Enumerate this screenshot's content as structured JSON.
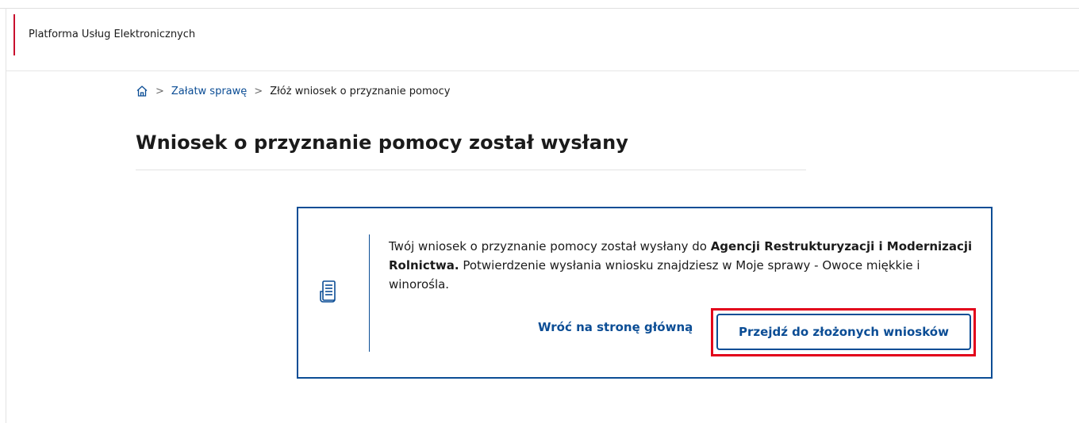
{
  "header": {
    "title": "Platforma Usług Elektronicznych"
  },
  "breadcrumb": {
    "items": [
      {
        "label": "Załatw sprawę"
      },
      {
        "label": "Złóż wniosek o przyznanie pomocy"
      }
    ],
    "separator": ">"
  },
  "page": {
    "title": "Wniosek o przyznanie pomocy został wysłany"
  },
  "panel": {
    "text_part1": "Twój wniosek o przyznanie pomocy został wysłany do ",
    "text_bold": "Agencji Restrukturyzacji i Modernizacji Rolnictwa.",
    "text_part2": " Potwierdzenie wysłania wniosku znajdziesz w Moje sprawy - Owoce miękkie i winorośla.",
    "link_home_label": "Wróć na stronę główną",
    "primary_button_label": "Przejdź do złożonych wniosków"
  },
  "colors": {
    "accent_blue": "#0b4d95",
    "header_accent_red": "#c8102e",
    "highlight_red": "#e2001a"
  },
  "icons": [
    "home-icon",
    "document-list-icon"
  ]
}
